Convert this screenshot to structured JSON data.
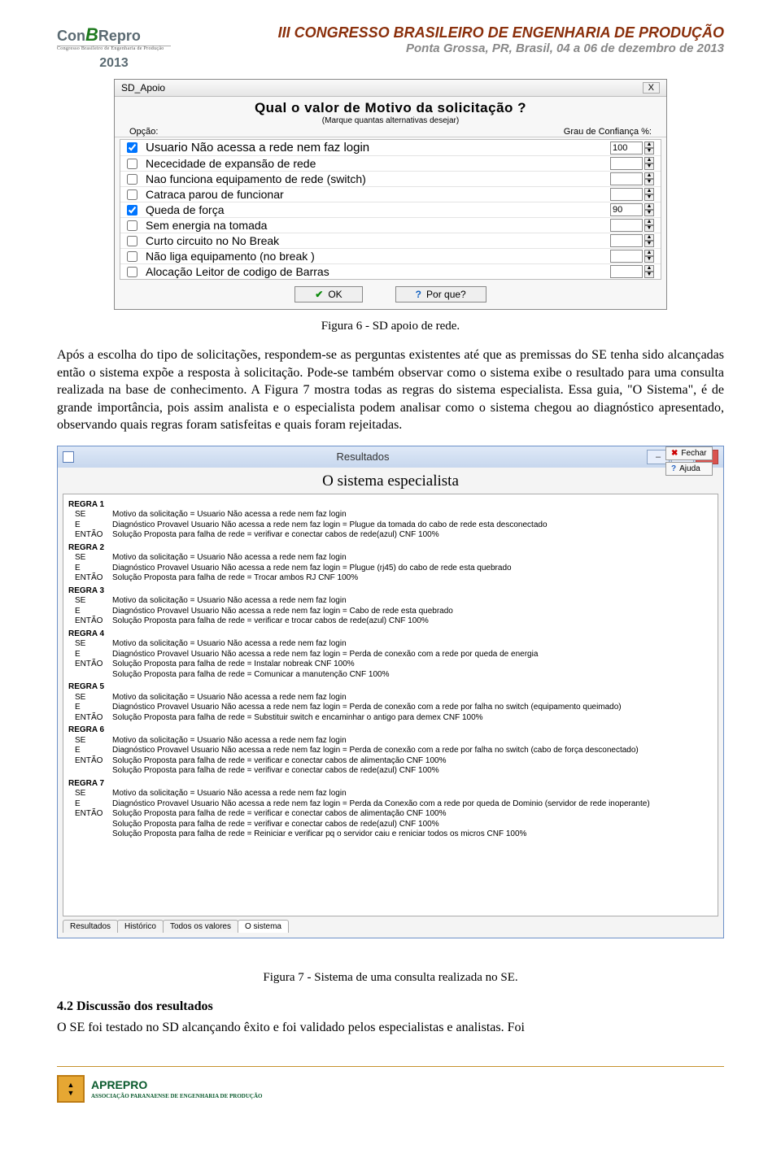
{
  "header": {
    "logo_con": "Con",
    "logo_b": "B",
    "logo_repro": "Repro",
    "logo_tag": "Congresso Brasileiro de Engenharia de Produção",
    "logo_year": "2013",
    "line1": "III CONGRESSO BRASILEIRO DE ENGENHARIA DE PRODUÇÃO",
    "line2": "Ponta Grossa, PR, Brasil, 04 a 06 de dezembro de 2013"
  },
  "dialog1": {
    "title": "SD_Apoio",
    "close": "X",
    "question": "Qual o valor de Motivo da solicitação ?",
    "subtitle": "(Marque quantas alternativas desejar)",
    "label_opcao": "Opção:",
    "label_conf": "Grau de Confiança %:",
    "options": [
      {
        "label": "Usuario Não acessa a rede nem faz login",
        "checked": true,
        "value": "100"
      },
      {
        "label": "Nececidade de expansão de rede",
        "checked": false,
        "value": ""
      },
      {
        "label": "Nao funciona equipamento de rede (switch)",
        "checked": false,
        "value": ""
      },
      {
        "label": "Catraca parou de funcionar",
        "checked": false,
        "value": ""
      },
      {
        "label": "Queda de força",
        "checked": true,
        "value": "90"
      },
      {
        "label": "Sem energia na tomada",
        "checked": false,
        "value": ""
      },
      {
        "label": "Curto circuito no No Break",
        "checked": false,
        "value": ""
      },
      {
        "label": "Não liga equipamento (no break )",
        "checked": false,
        "value": ""
      },
      {
        "label": "Alocação Leitor de codigo de Barras",
        "checked": false,
        "value": ""
      }
    ],
    "btn_ok": "OK",
    "btn_why": "Por que?"
  },
  "caption1": "Figura 6 - SD apoio de rede.",
  "para1": "Após a escolha do tipo de solicitações, respondem-se as perguntas existentes até que as premissas do SE tenha sido alcançadas então o sistema expõe a resposta à solicitação. Pode-se também observar como o sistema exibe o resultado para uma consulta realizada na base de conhecimento. A Figura 7 mostra todas as regras do sistema especialista. Essa guia, \"O Sistema\", é de grande importância, pois assim analista e o especialista podem analisar como o sistema chegou ao diagnóstico apresentado, observando quais regras foram satisfeitas e quais foram rejeitadas.",
  "dialog2": {
    "win_title": "Resultados",
    "min": "–",
    "max": "□",
    "close": "×",
    "inner_title": "O sistema especialista",
    "btn_close": "Fechar",
    "btn_help": "Ajuda",
    "tabs": [
      "Resultados",
      "Histórico",
      "Todos os valores",
      "O sistema"
    ],
    "rules": [
      {
        "name": "REGRA 1",
        "lines": [
          {
            "kw": "SE",
            "txt": "Motivo da solicitação = Usuario Não acessa a rede nem faz login"
          },
          {
            "kw": "E",
            "txt": "Diagnóstico Provavel  Usuario Não acessa a rede nem faz login = Plugue da tomada do cabo de rede esta desconectado"
          },
          {
            "kw": "ENTÃO",
            "txt": "Solução Proposta para falha de rede = verifivar e conectar cabos de rede(azul) CNF 100%"
          }
        ]
      },
      {
        "name": "REGRA 2",
        "lines": [
          {
            "kw": "SE",
            "txt": "Motivo da solicitação = Usuario Não acessa a rede nem faz login"
          },
          {
            "kw": "E",
            "txt": "Diagnóstico Provavel  Usuario Não acessa a rede nem faz login = Plugue (rj45) do cabo de rede esta  quebrado"
          },
          {
            "kw": "ENTÃO",
            "txt": "Solução Proposta para falha de rede = Trocar  ambos RJ CNF 100%"
          }
        ]
      },
      {
        "name": "REGRA 3",
        "lines": [
          {
            "kw": "SE",
            "txt": "Motivo da solicitação = Usuario Não acessa a rede nem faz login"
          },
          {
            "kw": "E",
            "txt": "Diagnóstico Provavel  Usuario Não acessa a rede nem faz login = Cabo de rede esta quebrado"
          },
          {
            "kw": "ENTÃO",
            "txt": "Solução Proposta para falha de rede = verificar e trocar cabos de rede(azul) CNF 100%"
          }
        ]
      },
      {
        "name": "REGRA 4",
        "lines": [
          {
            "kw": "SE",
            "txt": "Motivo da solicitação = Usuario Não acessa a rede nem faz login"
          },
          {
            "kw": "E",
            "txt": "Diagnóstico Provavel  Usuario Não acessa a rede nem faz login = Perda de conexão com a rede por queda de energia"
          },
          {
            "kw": "ENTÃO",
            "txt": "Solução Proposta para falha de rede = Instalar nobreak CNF 100%"
          },
          {
            "kw": "",
            "txt": "Solução Proposta para falha de rede = Comunicar a manutenção CNF 100%"
          }
        ]
      },
      {
        "name": "REGRA 5",
        "lines": [
          {
            "kw": "SE",
            "txt": "Motivo da solicitação = Usuario Não acessa a rede nem faz login"
          },
          {
            "kw": "E",
            "txt": "Diagnóstico Provavel  Usuario Não acessa a rede nem faz login = Perda de conexão com a rede por falha no switch (equipamento queimado)"
          },
          {
            "kw": "ENTÃO",
            "txt": "Solução Proposta para falha de rede = Substituir switch e encaminhar o antigo para demex CNF 100%"
          }
        ]
      },
      {
        "name": "REGRA 6",
        "lines": [
          {
            "kw": "SE",
            "txt": "Motivo da solicitação = Usuario Não acessa a rede nem faz login"
          },
          {
            "kw": "E",
            "txt": "Diagnóstico Provavel  Usuario Não acessa a rede nem faz login = Perda de conexão com a rede por falha no switch (cabo de força desconectado)"
          },
          {
            "kw": "ENTÃO",
            "txt": "Solução Proposta para falha de rede = verificar e conectar cabos de alimentação CNF 100%"
          },
          {
            "kw": "",
            "txt": "Solução Proposta para falha de rede = verifivar e conectar cabos de rede(azul) CNF 100%"
          }
        ]
      },
      {
        "name": "REGRA 7",
        "lines": [
          {
            "kw": "SE",
            "txt": "Motivo da solicitação = Usuario Não acessa a rede nem faz login"
          },
          {
            "kw": "E",
            "txt": "Diagnóstico Provavel  Usuario Não acessa a rede nem faz login = Perda da Conexão com a rede por queda de Dominio (servidor de rede inoperante)"
          },
          {
            "kw": "ENTÃO",
            "txt": "Solução Proposta para falha de rede = verificar e conectar cabos de alimentação CNF 100%"
          },
          {
            "kw": "",
            "txt": "Solução Proposta para falha de rede = verifivar e conectar cabos de rede(azul) CNF 100%"
          },
          {
            "kw": "",
            "txt": "Solução Proposta para falha de rede = Reiniciar e verificar pq o servidor caiu  e reniciar todos os micros CNF 100%"
          }
        ]
      }
    ]
  },
  "caption2": "Figura 7 - Sistema de uma consulta realizada no SE.",
  "section_h": "4.2 Discussão dos resultados",
  "para2": "O SE foi testado no SD alcançando êxito e foi validado pelos especialistas e analistas. Foi",
  "footer": {
    "logo_txt": "APREPRO",
    "logo_sub": "ASSOCIAÇÃO PARANAENSE DE\nENGENHARIA DE PRODUÇÃO"
  }
}
